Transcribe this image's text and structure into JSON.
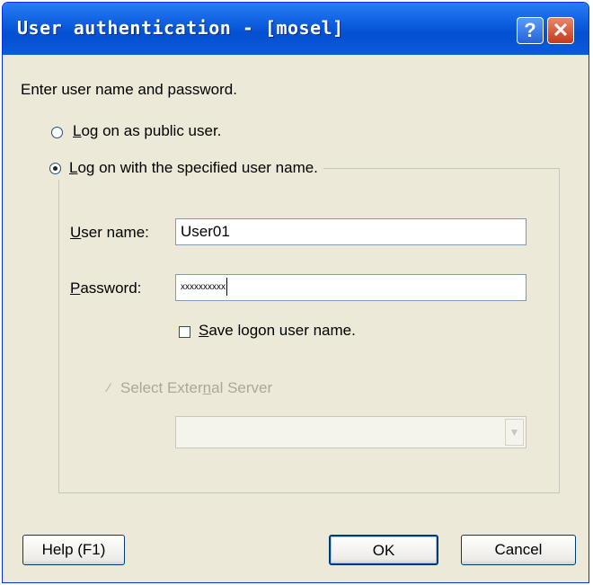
{
  "window": {
    "title": "User authentication - [mosel]",
    "help_glyph": "?",
    "close_glyph": "✕"
  },
  "prompt": "Enter user name and password.",
  "options": {
    "public_user": {
      "label_hotkey": "L",
      "label_rest": "og on as public user.",
      "selected": false
    },
    "specified_user": {
      "label_hotkey": "L",
      "label_rest": "og on with the specified user name.",
      "selected": true
    }
  },
  "form": {
    "username_label_hotkey": "U",
    "username_label_rest": "ser name:",
    "username_value": "User01",
    "password_label_hotkey": "P",
    "password_label_rest": "assword:",
    "password_mask": "xxxxxxxxxx",
    "save_logon_before": "",
    "save_logon_hotkey": "S",
    "save_logon_rest": "ave logon user name.",
    "save_logon_checked": false,
    "external_before": "Select Exter",
    "external_hotkey": "n",
    "external_rest": "al Server",
    "external_server_value": ""
  },
  "buttons": {
    "help": "Help (F1)",
    "ok": "OK",
    "cancel": "Cancel"
  }
}
